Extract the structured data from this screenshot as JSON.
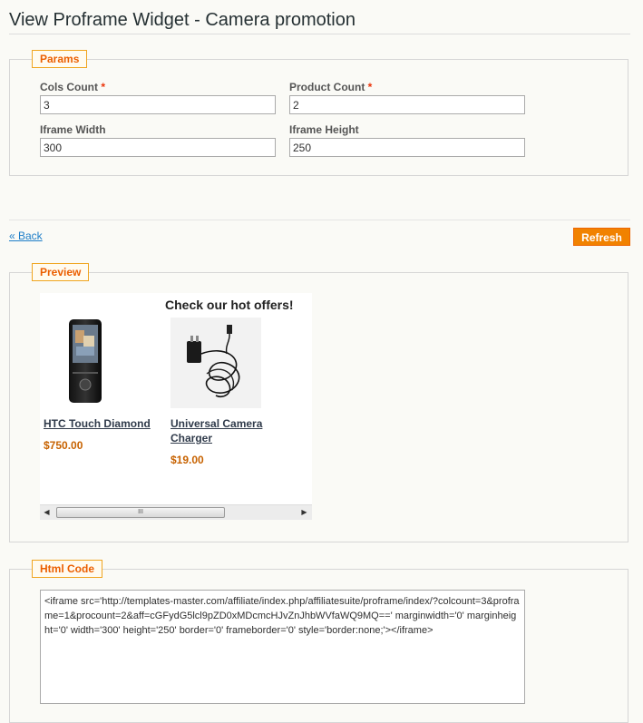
{
  "page": {
    "title": "View Proframe Widget - Camera promotion"
  },
  "params": {
    "legend": "Params",
    "cols_count": {
      "label": "Cols Count",
      "required_mark": "*",
      "value": "3"
    },
    "product_count": {
      "label": "Product Count",
      "required_mark": "*",
      "value": "2"
    },
    "iframe_width": {
      "label": "Iframe Width",
      "value": "300"
    },
    "iframe_height": {
      "label": "Iframe Height",
      "value": "250"
    }
  },
  "actions": {
    "back_label": "« Back",
    "refresh_label": "Refresh"
  },
  "preview": {
    "legend": "Preview",
    "heading": "Check our hot offers!",
    "products": [
      {
        "name": "HTC Touch Diamond",
        "price": "$750.00",
        "image_icon": "smartphone-image"
      },
      {
        "name": "Universal Camera Charger",
        "price": "$19.00",
        "image_icon": "charger-cable-image"
      }
    ],
    "scrollbar": {
      "left_arrow": "◀",
      "right_arrow": "▶",
      "grip": "III"
    }
  },
  "html_code": {
    "legend": "Html Code",
    "code": "<iframe src='http://templates-master.com/affiliate/index.php/affiliatesuite/proframe/index/?colcount=3&proframe=1&procount=2&aff=cGFydG5lcl9pZD0xMDcmcHJvZnJhbWVfaWQ9MQ==' marginwidth='0' marginheight='0' width='300' height='250' border='0' frameborder='0' style='border:none;'></iframe>"
  },
  "colors": {
    "accent": "#eb5e00",
    "button": "#f18200",
    "link": "#1e7ec8",
    "price": "#c76200"
  }
}
